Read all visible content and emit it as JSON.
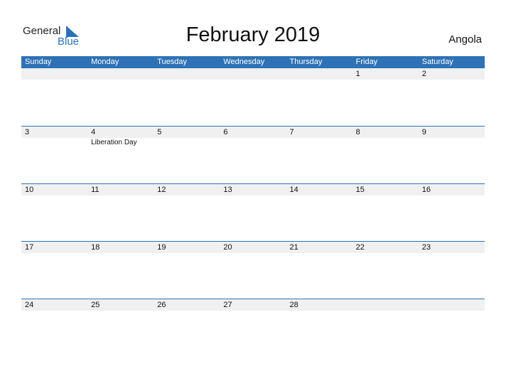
{
  "logo": {
    "line1": "General",
    "line2": "Blue"
  },
  "title": "February 2019",
  "country": "Angola",
  "colors": {
    "accent": "#2e72b5",
    "date_bar": "#f0f0f0"
  },
  "weekdays": [
    "Sunday",
    "Monday",
    "Tuesday",
    "Wednesday",
    "Thursday",
    "Friday",
    "Saturday"
  ],
  "weeks": [
    {
      "dates": [
        "",
        "",
        "",
        "",
        "",
        "1",
        "2"
      ],
      "events": [
        "",
        "",
        "",
        "",
        "",
        "",
        ""
      ]
    },
    {
      "dates": [
        "3",
        "4",
        "5",
        "6",
        "7",
        "8",
        "9"
      ],
      "events": [
        "",
        "Liberation Day",
        "",
        "",
        "",
        "",
        ""
      ]
    },
    {
      "dates": [
        "10",
        "11",
        "12",
        "13",
        "14",
        "15",
        "16"
      ],
      "events": [
        "",
        "",
        "",
        "",
        "",
        "",
        ""
      ]
    },
    {
      "dates": [
        "17",
        "18",
        "19",
        "20",
        "21",
        "22",
        "23"
      ],
      "events": [
        "",
        "",
        "",
        "",
        "",
        "",
        ""
      ]
    },
    {
      "dates": [
        "24",
        "25",
        "26",
        "27",
        "28",
        "",
        ""
      ],
      "events": [
        "",
        "",
        "",
        "",
        "",
        "",
        ""
      ]
    }
  ]
}
